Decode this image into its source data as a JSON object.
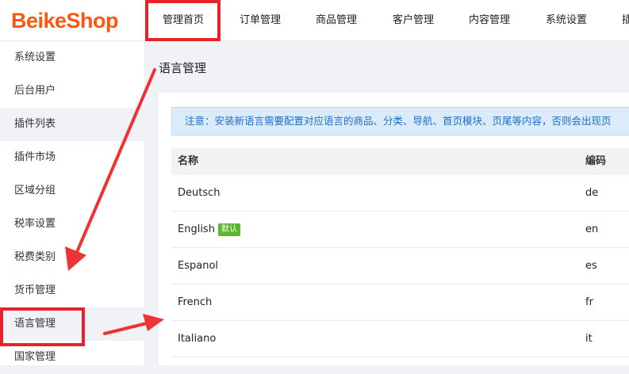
{
  "header": {
    "logo": "BeikeShop",
    "nav": [
      {
        "label": "管理首页",
        "active": true
      },
      {
        "label": "订单管理"
      },
      {
        "label": "商品管理"
      },
      {
        "label": "客户管理"
      },
      {
        "label": "内容管理"
      },
      {
        "label": "系统设置"
      },
      {
        "label": "插"
      }
    ]
  },
  "sidebar": {
    "items": [
      {
        "label": "系统设置"
      },
      {
        "label": "后台用户"
      },
      {
        "label": "插件列表"
      },
      {
        "label": "插件市场"
      },
      {
        "label": "区域分组"
      },
      {
        "label": "税率设置"
      },
      {
        "label": "税费类别"
      },
      {
        "label": "货币管理"
      },
      {
        "label": "语言管理",
        "active": true
      },
      {
        "label": "国家管理"
      }
    ]
  },
  "main": {
    "title": "语言管理",
    "notice": "注意：安装新语言需要配置对应语言的商品、分类、导航、首页模块、页尾等内容，否则会出现页",
    "table": {
      "columns": [
        "名称",
        "编码"
      ],
      "rows": [
        {
          "name": "Deutsch",
          "code": "de"
        },
        {
          "name": "English",
          "code": "en",
          "badge": "默认"
        },
        {
          "name": "Espanol",
          "code": "es"
        },
        {
          "name": "French",
          "code": "fr"
        },
        {
          "name": "Italiano",
          "code": "it"
        }
      ]
    }
  },
  "colors": {
    "brand": "#fd560f",
    "highlight": "#e8222b",
    "badge": "#5cb82a",
    "notice_text": "#1a6fc9",
    "notice_bg": "#dcebfa"
  }
}
